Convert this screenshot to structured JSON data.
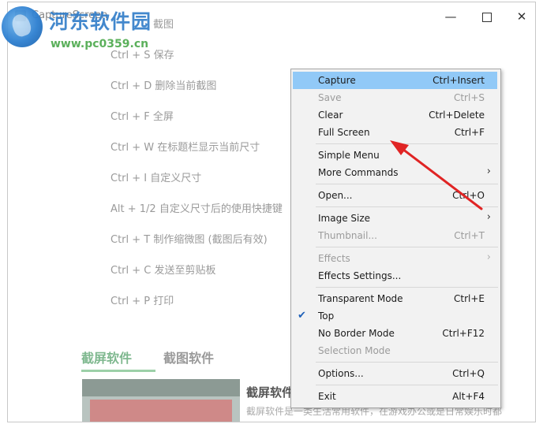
{
  "window": {
    "title": "CaptureScreen"
  },
  "watermark": {
    "title": "河东软件园",
    "url": "www.pc0359.cn"
  },
  "shortcuts": [
    "截图",
    "Ctrl + S 保存",
    "Ctrl + D 删除当前截图",
    "Ctrl + F 全屏",
    "Ctrl + W 在标题栏显示当前尺寸",
    "Ctrl + I 自定义尺寸",
    "Alt + 1/2 自定义尺寸后的使用快捷键",
    "Ctrl + T 制作缩微图 (截图后有效)",
    "Ctrl + C 发送至剪贴板",
    "Ctrl + P 打印"
  ],
  "tabs": [
    "截屏软件",
    "截图软件"
  ],
  "card": {
    "title": "截屏软件",
    "desc": "截屏软件是一类生活常用软件，在游戏办公或是日常娱乐时都"
  },
  "menu": {
    "items": [
      {
        "label": "Capture",
        "shortcut": "Ctrl+Insert"
      },
      {
        "label": "Save",
        "shortcut": "Ctrl+S"
      },
      {
        "label": "Clear",
        "shortcut": "Ctrl+Delete"
      },
      {
        "label": "Full Screen",
        "shortcut": "Ctrl+F"
      },
      {
        "label": "Simple Menu",
        "shortcut": ""
      },
      {
        "label": "More Commands",
        "shortcut": ""
      },
      {
        "label": "Open...",
        "shortcut": "Ctrl+O"
      },
      {
        "label": "Image Size",
        "shortcut": ""
      },
      {
        "label": "Thumbnail...",
        "shortcut": "Ctrl+T"
      },
      {
        "label": "Effects",
        "shortcut": ""
      },
      {
        "label": "Effects Settings...",
        "shortcut": ""
      },
      {
        "label": "Transparent Mode",
        "shortcut": "Ctrl+E"
      },
      {
        "label": "Top",
        "shortcut": ""
      },
      {
        "label": "No Border Mode",
        "shortcut": "Ctrl+F12"
      },
      {
        "label": "Selection Mode",
        "shortcut": ""
      },
      {
        "label": "Options...",
        "shortcut": "Ctrl+Q"
      },
      {
        "label": "Exit",
        "shortcut": "Alt+F4"
      }
    ]
  },
  "colors": {
    "highlight": "#91c9f7",
    "arrow": "#e02424",
    "tab_active": "#7fb88f"
  }
}
